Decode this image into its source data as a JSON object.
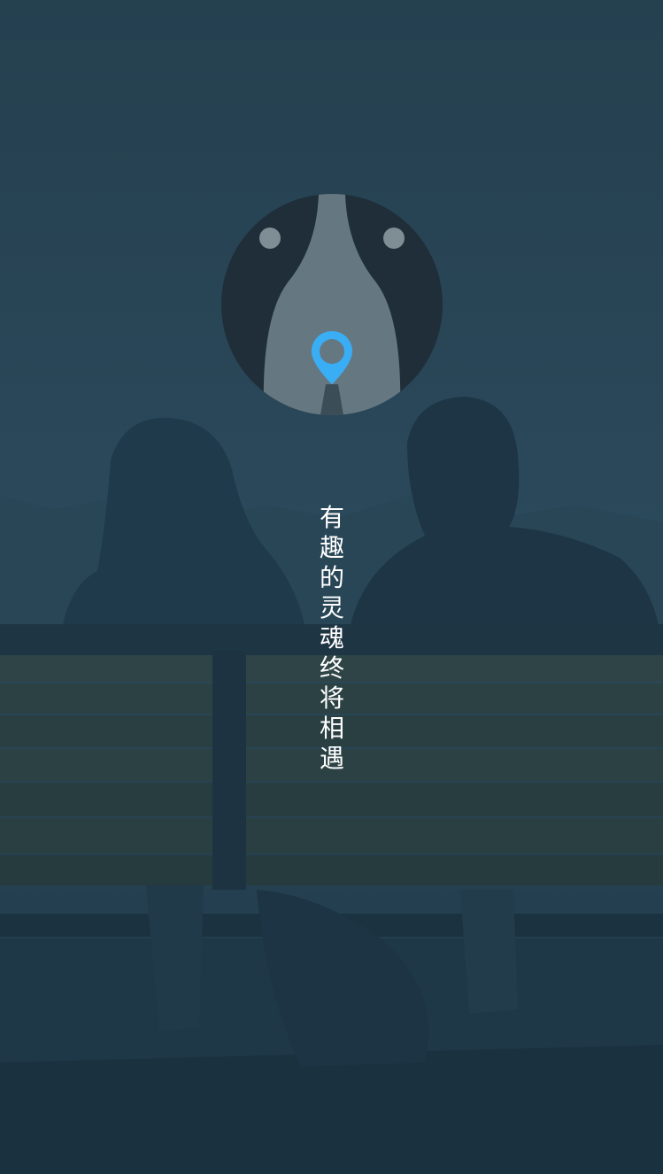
{
  "splash": {
    "slogan": "有趣的灵魂终将相遇"
  },
  "logo": {
    "icon": "app-logo-icon",
    "location_pin_icon": "map-pin-icon"
  },
  "background": {
    "description_icon": "couple-on-bench-photo"
  },
  "colors": {
    "overlay": "#213c4c",
    "logo_dark": "#1f2e39",
    "logo_light": "#657882",
    "pin": "#39aef5",
    "text": "#ffffff"
  }
}
